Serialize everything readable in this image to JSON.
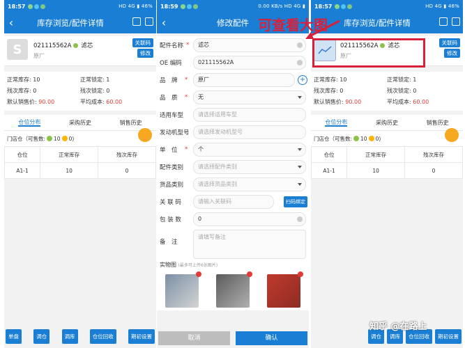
{
  "screen1": {
    "status": {
      "time": "18:57",
      "right": "HD 4G ▮ 46%"
    },
    "title": "库存浏览/配件详情",
    "code": "021115562A",
    "name": "滤芯",
    "brand": "原厂",
    "btn_link": "关联码",
    "btn_edit": "修改",
    "stock": [
      {
        "label": "正常库存:",
        "value": "10"
      },
      {
        "label": "正常锁定:",
        "value": "1"
      },
      {
        "label": "残次库存:",
        "value": "0"
      },
      {
        "label": "残次锁定:",
        "value": "0"
      },
      {
        "label": "默认销售价:",
        "value": "90.00"
      },
      {
        "label": "平均成本:",
        "value": "60.00"
      }
    ],
    "tabs": [
      "仓位分布",
      "采购历史",
      "销售历史"
    ],
    "store": {
      "name": "门店仓（可售数:",
      "a": "10",
      "b": "0",
      "end": ")"
    },
    "table": {
      "headers": [
        "仓位",
        "正常库存",
        "残次库存"
      ],
      "rows": [
        [
          "A1-1",
          "10",
          "0"
        ]
      ]
    },
    "bottom": [
      "单盘",
      "调仓",
      "调库",
      "仓位回收",
      "期初设置"
    ]
  },
  "screen2": {
    "status": {
      "time": "18:59",
      "right": "0.00 KB/s HD 4G ▮"
    },
    "title": "修改配件",
    "fields": [
      {
        "label": "配件名称",
        "req": "*",
        "value": "滤芯",
        "ph": false,
        "type": "x"
      },
      {
        "label": "OE 编码",
        "req": "",
        "value": "021115562A",
        "ph": false,
        "type": "x"
      },
      {
        "label": "品　牌",
        "req": "*",
        "value": "原厂",
        "ph": false,
        "type": "plus"
      },
      {
        "label": "品　质",
        "req": "*",
        "value": "无",
        "ph": false,
        "type": "dd"
      },
      {
        "label": "适用车型",
        "req": "",
        "value": "请选择适用车型",
        "ph": true,
        "type": ""
      },
      {
        "label": "发动机型号",
        "req": "",
        "value": "请选择发动机型号",
        "ph": true,
        "type": ""
      },
      {
        "label": "单　位",
        "req": "*",
        "value": "个",
        "ph": false,
        "type": "dd"
      },
      {
        "label": "配件类别",
        "req": "",
        "value": "请选择配件类别",
        "ph": true,
        "type": "dd"
      },
      {
        "label": "货品类别",
        "req": "",
        "value": "请选择货品类别",
        "ph": true,
        "type": "dd"
      },
      {
        "label": "关 联 码",
        "req": "",
        "value": "请输入关联码",
        "ph": true,
        "type": "scan"
      },
      {
        "label": "包 装 数",
        "req": "",
        "value": "0",
        "ph": false,
        "type": "x"
      }
    ],
    "scan_btn": "扫码绑定",
    "remark_label": "备　注",
    "remark_ph": "请填写备注",
    "photos_label": "实物图",
    "photos_hint": "(最多可上传6张图片)",
    "cancel": "取消",
    "confirm": "确认"
  },
  "screen3": {
    "status": {
      "time": "18:57",
      "right": "HD 4G ▮ 46%"
    },
    "title": "库存浏览/配件详情",
    "code": "021115562A",
    "name": "滤芯",
    "brand": "原厂",
    "btn_link": "关联码",
    "btn_edit": "修改",
    "stock": [
      {
        "label": "正常库存:",
        "value": "10"
      },
      {
        "label": "正常锁定:",
        "value": "1"
      },
      {
        "label": "残次库存:",
        "value": "0"
      },
      {
        "label": "残次锁定:",
        "value": "0"
      },
      {
        "label": "默认销售价:",
        "value": "90.00"
      },
      {
        "label": "平均成本:",
        "value": "60.00"
      }
    ],
    "tabs": [
      "仓位分布",
      "采购历史",
      "销售历史"
    ],
    "store": {
      "name": "门店仓（可售数:",
      "a": "10",
      "b": "0",
      "end": ")"
    },
    "table": {
      "headers": [
        "仓位",
        "正常库存",
        "残次库存"
      ],
      "rows": [
        [
          "A1-1",
          "10",
          "0"
        ]
      ]
    },
    "bottom": [
      "调仓",
      "调库",
      "仓位回收",
      "期初设置"
    ]
  },
  "annotation": "可查看大图",
  "watermark": "知乎 @在路上"
}
